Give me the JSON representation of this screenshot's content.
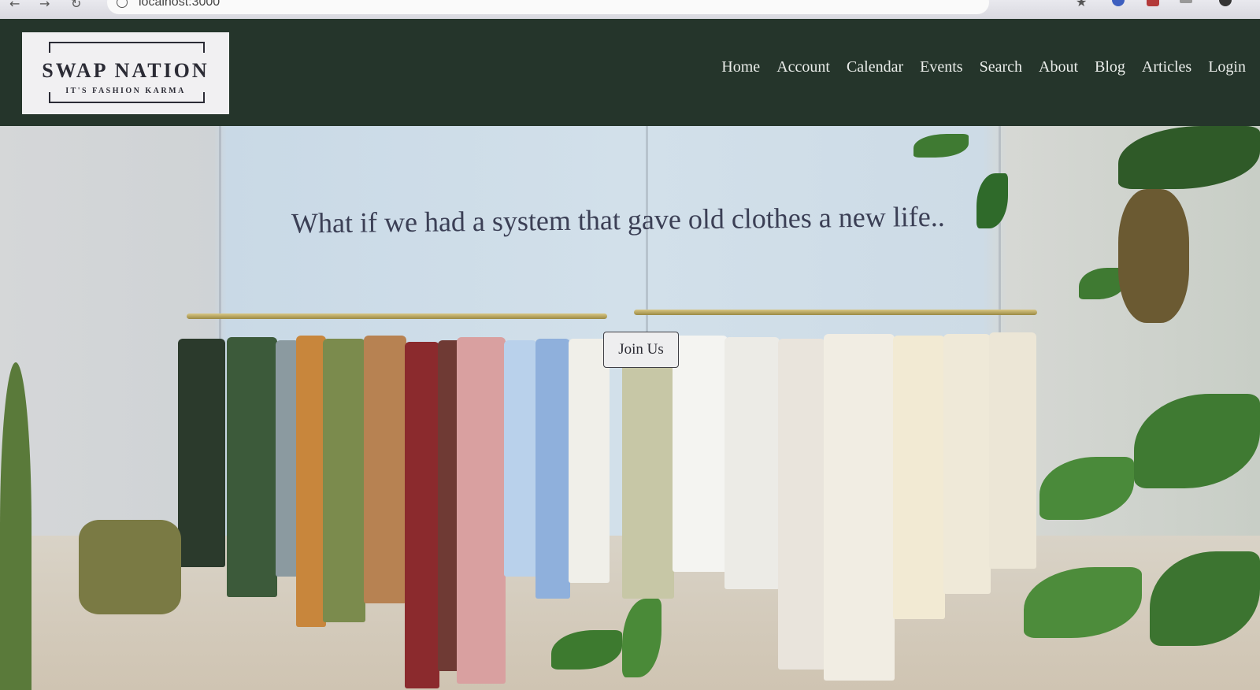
{
  "browser": {
    "url": "localhost:3000",
    "back_icon": "arrow-left-icon",
    "forward_icon": "arrow-right-icon",
    "reload_icon": "reload-icon"
  },
  "logo": {
    "title": "SWAP NATION",
    "tagline": "IT'S FASHION KARMA"
  },
  "nav": {
    "items": [
      "Home",
      "Account",
      "Calendar",
      "Events",
      "Search",
      "About",
      "Blog",
      "Articles",
      "Login"
    ]
  },
  "hero": {
    "headline": "What if we had a system that gave old clothes a new life..",
    "cta_label": "Join Us"
  },
  "colors": {
    "header_bg": "#25352b",
    "nav_text": "#e9ece9",
    "logo_bg": "#f1f0f2",
    "headline_text": "#3b3f55"
  }
}
